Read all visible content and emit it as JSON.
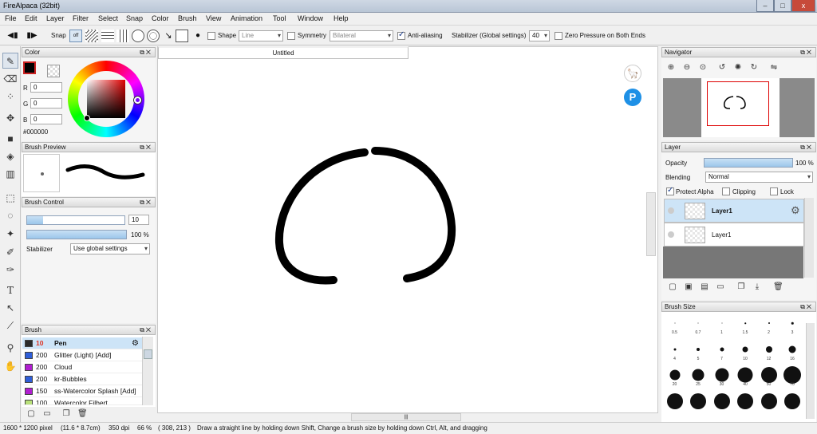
{
  "window": {
    "title": "FireAlpaca (32bit)",
    "controls": {
      "minimize": "–",
      "maximize": "□",
      "close": "x"
    }
  },
  "menu": [
    "File",
    "Edit",
    "Layer",
    "Filter",
    "Select",
    "Snap",
    "Color",
    "Brush",
    "View",
    "Animation",
    "Tool",
    "Window",
    "Help"
  ],
  "toolbar": {
    "snap_label": "Snap",
    "snap_off": "off",
    "shape_label": "Shape",
    "shape_value": "Line",
    "symmetry_label": "Symmetry",
    "symmetry_value": "Bilateral",
    "antialias_label": "Anti-aliasing",
    "antialias_checked": true,
    "stabilizer_label": "Stabilizer (Global settings)",
    "stabilizer_value": "40",
    "zero_pressure_label": "Zero Pressure on Both Ends"
  },
  "color_panel": {
    "title": "Color",
    "r_label": "R",
    "g_label": "G",
    "b_label": "B",
    "r": "0",
    "g": "0",
    "b": "0",
    "hex": "#000000",
    "primary": "#000000"
  },
  "brush_preview_panel": {
    "title": "Brush Preview"
  },
  "brush_control_panel": {
    "title": "Brush Control",
    "size": "10",
    "opacity": "100 %",
    "size_fraction": 0.16,
    "opacity_fraction": 1.0,
    "stabilizer_label": "Stabilizer",
    "stabilizer_value": "Use global settings"
  },
  "brush_panel": {
    "title": "Brush",
    "items": [
      {
        "size": "10",
        "name": "Pen",
        "color": "#2b2b2b",
        "selected": true
      },
      {
        "size": "200",
        "name": "Glitter (Light) [Add]",
        "color": "#2f5ed8"
      },
      {
        "size": "200",
        "name": "Cloud",
        "color": "#b01ed0"
      },
      {
        "size": "200",
        "name": "kr-Bubbles",
        "color": "#2f5ed8"
      },
      {
        "size": "150",
        "name": "ss-Watercolor Splash [Add]",
        "color": "#b01ed0"
      },
      {
        "size": "100",
        "name": "Watercolor Filbert",
        "color": "#b8e07a"
      }
    ]
  },
  "document": {
    "tab": "Untitled"
  },
  "navigator_panel": {
    "title": "Navigator"
  },
  "layer_panel": {
    "title": "Layer",
    "opacity_label": "Opacity",
    "opacity_value": "100 %",
    "blending_label": "Blending",
    "blending_value": "Normal",
    "protect_alpha": "Protect Alpha",
    "clipping": "Clipping",
    "lock": "Lock",
    "layers": [
      {
        "name": "Layer1",
        "selected": true
      },
      {
        "name": "Layer1",
        "selected": false
      }
    ]
  },
  "brush_size_panel": {
    "title": "Brush Size",
    "rows": [
      [
        "0.5",
        "0.7",
        "1",
        "1.5",
        "2",
        "3"
      ],
      [
        "4",
        "5",
        "7",
        "10",
        "12",
        "16"
      ],
      [
        "20",
        "25",
        "30",
        "40",
        "50",
        "70"
      ],
      [
        "",
        "",
        "",
        "",
        "",
        ""
      ]
    ]
  },
  "status": {
    "dimensions": "1600 * 1200 pixel",
    "physical": "(11.6 * 8.7cm)",
    "dpi": "350 dpi",
    "zoom": "66 %",
    "cursor": "( 308, 213 )",
    "hint": "Draw a straight line by holding down Shift, Change a brush size by holding down Ctrl, Alt, and dragging"
  }
}
